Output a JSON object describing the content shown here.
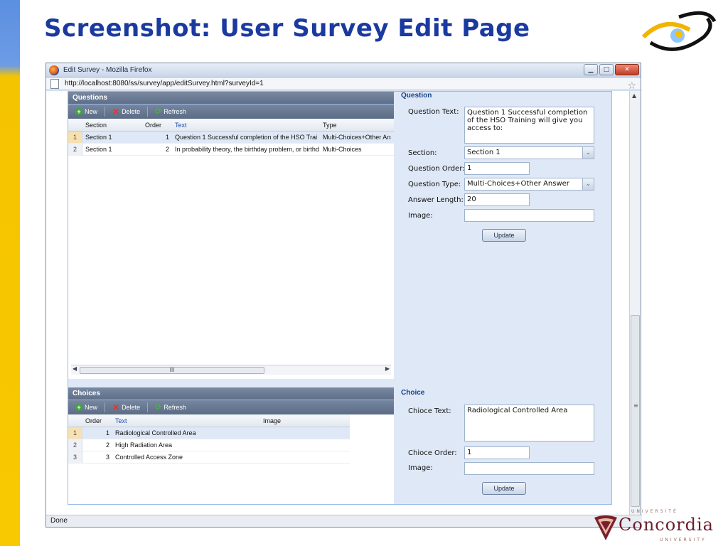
{
  "slide": {
    "title": "Screenshot: User Survey Edit Page"
  },
  "browser": {
    "window_title": "Edit Survey - Mozilla Firefox",
    "url": "http://localhost:8080/ss/survey/app/editSurvey.html?surveyId=1",
    "status": "Done",
    "hscroll_grip": "III",
    "vscroll_grip": "≡"
  },
  "questions_panel": {
    "title": "Questions",
    "toolbar": {
      "new": "New",
      "delete": "Delete",
      "refresh": "Refresh"
    },
    "columns": [
      "Section",
      "Order",
      "Text",
      "Type"
    ],
    "rows": [
      {
        "num": "1",
        "section": "Section 1",
        "order": "1",
        "text": "Question 1 Successful completion of the HSO Trai",
        "type": "Multi-Choices+Other Ans"
      },
      {
        "num": "2",
        "section": "Section 1",
        "order": "2",
        "text": "In probability theory, the birthday problem, or birthd",
        "type": "Multi-Choices"
      }
    ]
  },
  "question_form": {
    "title": "Question",
    "text_label": "Question Text:",
    "text_value": "Question 1 Successful completion of the HSO Training will give you access to:",
    "section_label": "Section:",
    "section_value": "Section 1",
    "order_label": "Question Order:",
    "order_value": "1",
    "type_label": "Question Type:",
    "type_value": "Multi-Choices+Other Answer",
    "length_label": "Answer Length:",
    "length_value": "20",
    "image_label": "Image:",
    "image_value": "",
    "update": "Update"
  },
  "choices_panel": {
    "title": "Choices",
    "toolbar": {
      "new": "New",
      "delete": "Delete",
      "refresh": "Refresh"
    },
    "columns": [
      "Order",
      "Text",
      "Image"
    ],
    "rows": [
      {
        "num": "1",
        "order": "1",
        "text": "Radiological Controlled Area",
        "image": ""
      },
      {
        "num": "2",
        "order": "2",
        "text": "High Radiation Area",
        "image": ""
      },
      {
        "num": "3",
        "order": "3",
        "text": "Controlled Access Zone",
        "image": ""
      }
    ]
  },
  "choice_form": {
    "title": "Choice",
    "text_label": "Chioce Text:",
    "text_value": "Radiological Controlled Area",
    "order_label": "Chioce Order:",
    "order_value": "1",
    "image_label": "Image:",
    "image_value": "",
    "update": "Update"
  },
  "branding": {
    "concordia": "Concordia",
    "universite": "UNIVERSITÉ",
    "university": "UNIVERSITY"
  }
}
